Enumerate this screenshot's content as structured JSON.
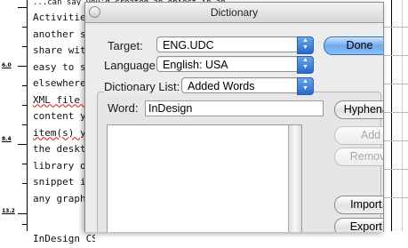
{
  "document": {
    "top_strip": "...can say you'd created an object in an",
    "lines": [
      "Activities",
      "another spr",
      "share with",
      "easy to sav",
      "elsewhere.",
      "XML file th",
      "content you",
      "item(s) you",
      "the desktop",
      "library or",
      "snippet int",
      "any graphic",
      "",
      "",
      "InDesign CS"
    ],
    "ruler_labels": [
      "6.0",
      "8.4",
      "13.2"
    ]
  },
  "dialog": {
    "title": "Dictionary",
    "target_label": "Target:",
    "target_value": "ENG.UDC",
    "language_label": "Language:",
    "language_value": "English: USA",
    "done_label": "Done",
    "dictionary_list_label": "Dictionary List:",
    "dictionary_list_value": "Added Words",
    "word_label": "Word:",
    "word_value": "InDesign",
    "hyphenate_label": "Hyphenate",
    "add_label": "Add",
    "remove_label": "Remove",
    "import_label": "Import...",
    "export_label": "Export..."
  }
}
